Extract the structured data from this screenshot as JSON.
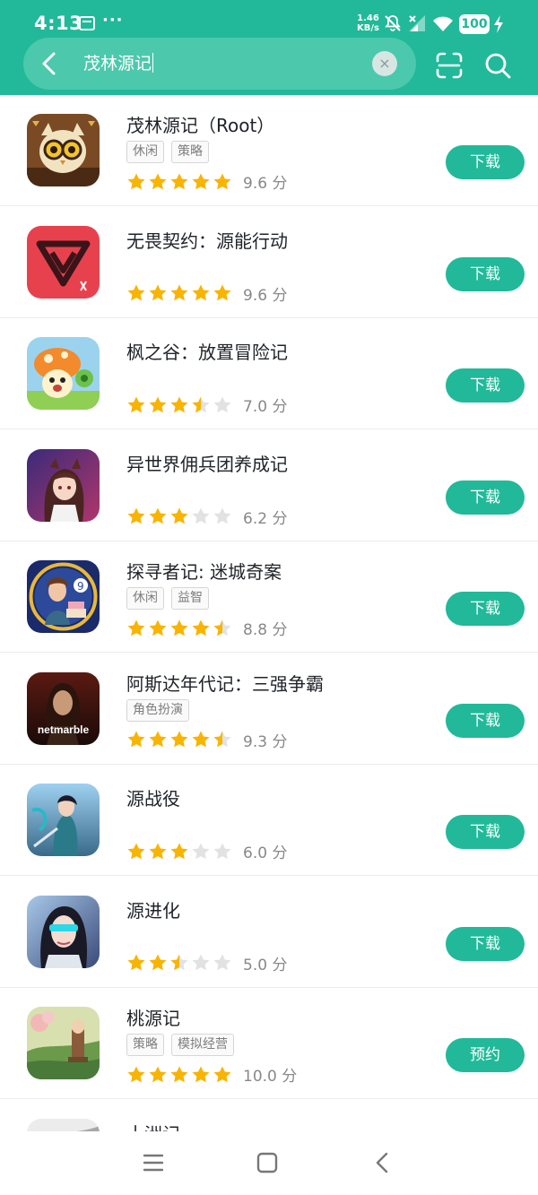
{
  "status_bar": {
    "time": "4:13",
    "notif_icon": "message-app-icon",
    "more": "···",
    "speed_value": "1.46",
    "speed_unit": "KB/s",
    "battery": "100"
  },
  "search": {
    "query": "茂林源记",
    "clear_label": "×",
    "back_icon": "back-arrow-icon",
    "scan_icon": "scan-icon",
    "search_icon": "search-icon"
  },
  "colors": {
    "brand": "#21b999",
    "star_active": "#f8b400",
    "star_inactive": "#e2e2e2"
  },
  "results": [
    {
      "title": "茂林源记（Root）",
      "tags": [
        "休闲",
        "策略"
      ],
      "rating": 5,
      "score": "9.6 分",
      "action": "下载"
    },
    {
      "title": "无畏契约：源能行动",
      "tags": [],
      "rating": 5,
      "score": "9.6 分",
      "action": "下载"
    },
    {
      "title": "枫之谷：放置冒险记",
      "tags": [],
      "rating": 3.5,
      "score": "7.0 分",
      "action": "下载"
    },
    {
      "title": "异世界佣兵团养成记",
      "tags": [],
      "rating": 3,
      "score": "6.2 分",
      "action": "下载"
    },
    {
      "title": "探寻者记: 迷城奇案",
      "tags": [
        "休闲",
        "益智"
      ],
      "rating": 4.5,
      "score": "8.8 分",
      "action": "下载"
    },
    {
      "title": "阿斯达年代记：三强争霸",
      "tags": [
        "角色扮演"
      ],
      "rating": 4.5,
      "score": "9.3 分",
      "action": "下载",
      "icon_text": "netmarble"
    },
    {
      "title": "源战役",
      "tags": [],
      "rating": 3,
      "score": "6.0 分",
      "action": "下载"
    },
    {
      "title": "源进化",
      "tags": [],
      "rating": 2.5,
      "score": "5.0 分",
      "action": "下载"
    },
    {
      "title": "桃源记",
      "tags": [
        "策略",
        "模拟经营"
      ],
      "rating": 5,
      "score": "10.0 分",
      "action": "预约"
    },
    {
      "title": "十洲记",
      "tags": [],
      "rating": 0,
      "score": "",
      "action": ""
    }
  ],
  "nav_bar": {
    "menu_icon": "menu-icon",
    "home_icon": "home-icon",
    "back_icon": "nav-back-icon"
  }
}
